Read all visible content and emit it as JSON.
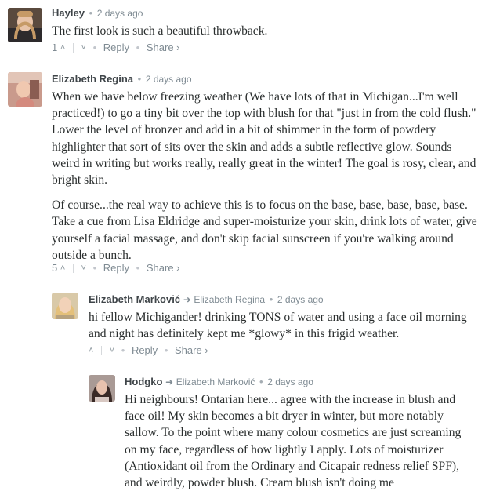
{
  "comments": [
    {
      "author": "Hayley",
      "time": "2 days ago",
      "paragraphs": [
        "The first look is such a beautiful throwback."
      ],
      "votes": "1",
      "reply_label": "Reply",
      "share_label": "Share ›"
    },
    {
      "author": "Elizabeth Regina",
      "time": "2 days ago",
      "paragraphs": [
        "When we have below freezing weather (We have lots of that in Michigan...I'm well practiced!) to go a tiny bit over the top with blush for that \"just in from the cold flush.\" Lower the level of bronzer and add in a bit of shimmer in the form of powdery highlighter that sort of sits over the skin and adds a subtle reflective glow. Sounds weird in writing but works really, really great in the winter! The goal is rosy, clear, and bright skin.",
        "Of course...the real way to achieve this is to focus on the base, base, base, base, base. Take a cue from Lisa Eldridge and super-moisturize your skin, drink lots of water, give yourself a facial massage, and don't skip facial sunscreen if you're walking around outside a bunch."
      ],
      "votes": "5",
      "reply_label": "Reply",
      "share_label": "Share ›"
    },
    {
      "author": "Elizabeth Marković",
      "in_reply_to": "Elizabeth Regina",
      "time": "2 days ago",
      "paragraphs": [
        "hi fellow Michigander! drinking TONS of water and using a face oil morning and night has definitely kept me *glowy* in this frigid weather."
      ],
      "votes": "",
      "reply_label": "Reply",
      "share_label": "Share ›"
    },
    {
      "author": "Hodgko",
      "in_reply_to": "Elizabeth Marković",
      "time": "2 days ago",
      "paragraphs": [
        "Hi neighbours! Ontarian here... agree with the increase in blush and face oil! My skin becomes a bit dryer in winter, but more notably sallow. To the point where many colour cosmetics are just screaming on my face, regardless of how lightly I apply. Lots of moisturizer (Antioxidant oil from the Ordinary and Cicapair redness relief SPF), and weirdly, powder blush. Cream blush isn't doing me"
      ]
    }
  ],
  "icons": {
    "upvote": "chevron-up-icon",
    "downvote": "chevron-down-icon",
    "reply_to": "reply-arrow-icon"
  },
  "colors": {
    "author": "#3f4549",
    "meta": "#7f8b93",
    "body_text": "#2a2e2e"
  }
}
